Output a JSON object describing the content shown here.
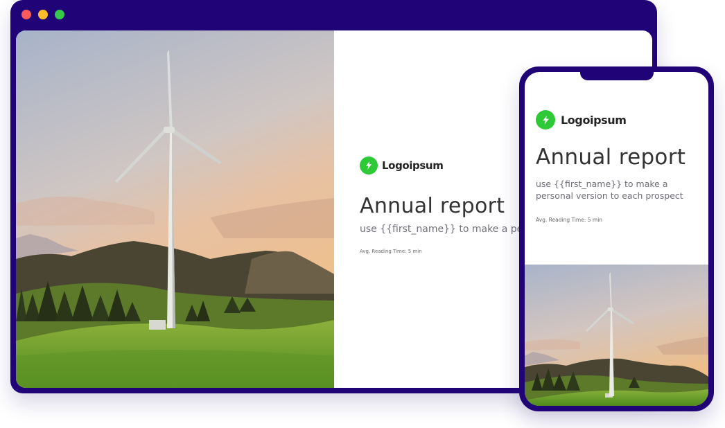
{
  "brand": {
    "name": "Logoipsum",
    "accent_color": "#2dc937",
    "frame_color": "#210378",
    "logo_icon": "lightning-bolt-icon"
  },
  "window_controls": [
    "close-dot",
    "minimize-dot",
    "maximize-dot"
  ],
  "desktop": {
    "headline": "Annual report",
    "subheadline": "use {{first_name}} to make a personal version to each prospect",
    "reading_time": "Avg. Reading Time: 5 min"
  },
  "mobile": {
    "headline": "Annual report",
    "subheadline": "use {{first_name}} to make a personal version to each prospect",
    "reading_time": "Avg. Reading Time: 5 min"
  }
}
